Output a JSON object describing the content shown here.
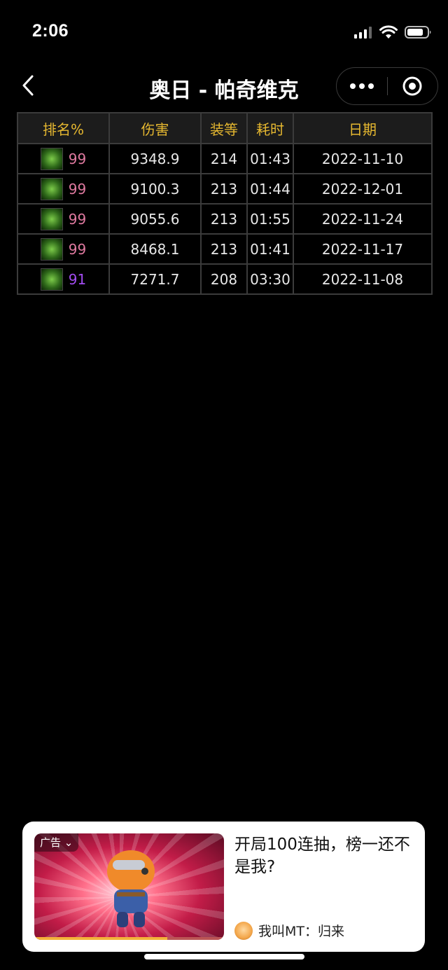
{
  "status_bar": {
    "time": "2:06"
  },
  "nav": {
    "title": "奥日 - 帕奇维克"
  },
  "table": {
    "headers": [
      "排名%",
      "伤害",
      "装等",
      "耗时",
      "日期"
    ],
    "rows": [
      {
        "percentile": "99",
        "percentile_color": "#e07aa0",
        "damage": "9348.9",
        "ilvl": "214",
        "duration": "01:43",
        "date": "2022-11-10"
      },
      {
        "percentile": "99",
        "percentile_color": "#e07aa0",
        "damage": "9100.3",
        "ilvl": "213",
        "duration": "01:44",
        "date": "2022-12-01"
      },
      {
        "percentile": "99",
        "percentile_color": "#e07aa0",
        "damage": "9055.6",
        "ilvl": "213",
        "duration": "01:55",
        "date": "2022-11-24"
      },
      {
        "percentile": "99",
        "percentile_color": "#e07aa0",
        "damage": "8468.1",
        "ilvl": "213",
        "duration": "01:41",
        "date": "2022-11-17"
      },
      {
        "percentile": "91",
        "percentile_color": "#a24cf0",
        "damage": "7271.7",
        "ilvl": "208",
        "duration": "03:30",
        "date": "2022-11-08"
      }
    ]
  },
  "ad": {
    "tag": "广告",
    "headline": "开局100连抽，榜一还不是我?",
    "source": "我叫MT：归来",
    "video_progress": 0.7
  },
  "colors": {
    "header_text": "#e6b830",
    "damage_text": "#c9f08a",
    "cell_border": "#3b3b3b"
  }
}
